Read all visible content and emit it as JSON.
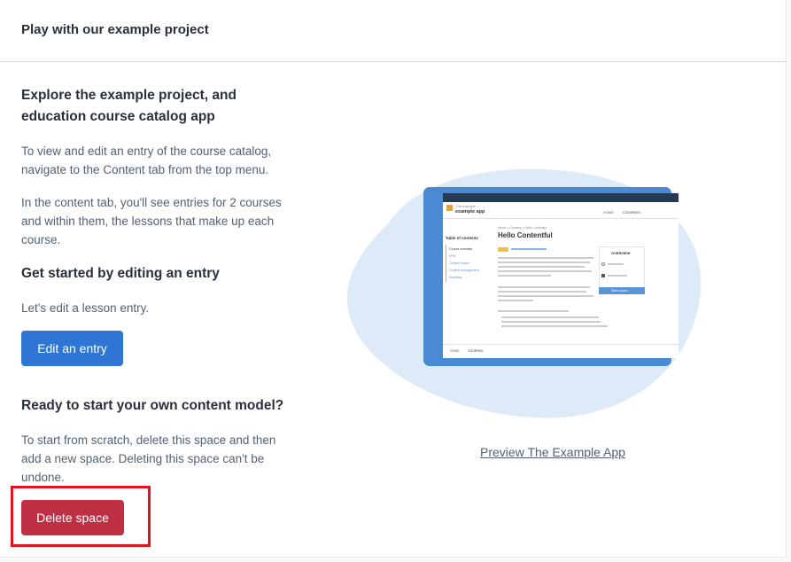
{
  "header": {
    "title": "Play with our example project"
  },
  "explore": {
    "title_line1": "Explore the example project, and",
    "title_line2": "education course catalog app",
    "p1_line1": "To view and edit an entry of the course catalog,",
    "p1_line2": "navigate to the Content tab from the top menu.",
    "p2_line1": "In the content tab, you'll see entries for 2 courses",
    "p2_line2": "and within them, the lessons that make up each",
    "p2_line3": "course."
  },
  "edit": {
    "title": "Get started by editing an entry",
    "text": "Let's edit a lesson entry.",
    "button_label": "Edit an entry"
  },
  "own_model": {
    "title": "Ready to start your own content model?",
    "line1": "To start from scratch, delete this space and then",
    "line2": "add a new space. Deleting this space can't be",
    "line3": "undone.",
    "button_label": "Delete space"
  },
  "preview": {
    "link_label": "Preview The Example App",
    "screen": {
      "logo_small": "The example",
      "logo_big": "example app",
      "nav_home": "HOME",
      "nav_courses": "COURSES",
      "breadcrumb": "Home > Courses > Hello Contentful",
      "page_title": "Hello Contentful",
      "toc_title": "Table of contents",
      "toc_items": [
        "Course overview",
        "APIs",
        "Content model",
        "Content management",
        "Summary"
      ],
      "overview_label": "OVERVIEW",
      "start_button": "Start course",
      "footer_home": "HOME",
      "footer_courses": "COURSES"
    }
  },
  "colors": {
    "primary": "#2e75d4",
    "danger": "#bf3045",
    "highlight": "#e0141e",
    "tablet": "#4a8ad4",
    "blob": "#dcebf7"
  }
}
